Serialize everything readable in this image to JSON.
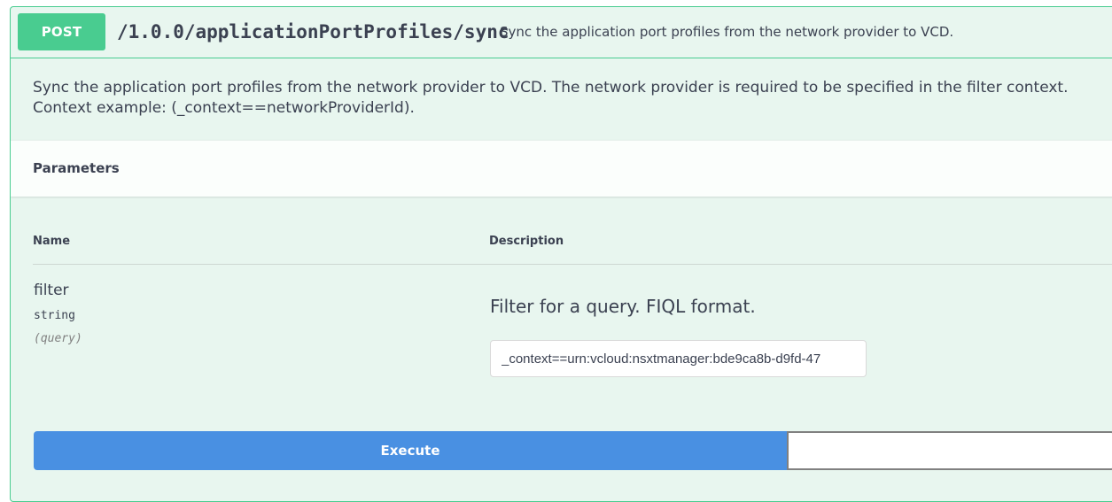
{
  "operation": {
    "method": "POST",
    "path": "/1.0.0/applicationPortProfiles/sync",
    "summary": "Sync the application port profiles from the network provider to VCD.",
    "description_line1": "Sync the application port profiles from the network provider to VCD. The network provider is required to be specified in the filter context.",
    "description_line2": "Context example: (_context==networkProviderId)."
  },
  "parameters": {
    "title": "Parameters",
    "columns": {
      "name": "Name",
      "description": "Description"
    },
    "items": [
      {
        "name": "filter",
        "type": "string",
        "in": "(query)",
        "description": "Filter for a query. FIQL format.",
        "value": "_context==urn:vcloud:nsxtmanager:bde9ca8b-d9fd-47"
      }
    ]
  },
  "actions": {
    "execute": "Execute",
    "clear": ""
  },
  "colors": {
    "post_green": "#49cc90",
    "panel_bg": "#e8f6ef",
    "execute_blue": "#4990e2",
    "text": "#3b4151"
  }
}
